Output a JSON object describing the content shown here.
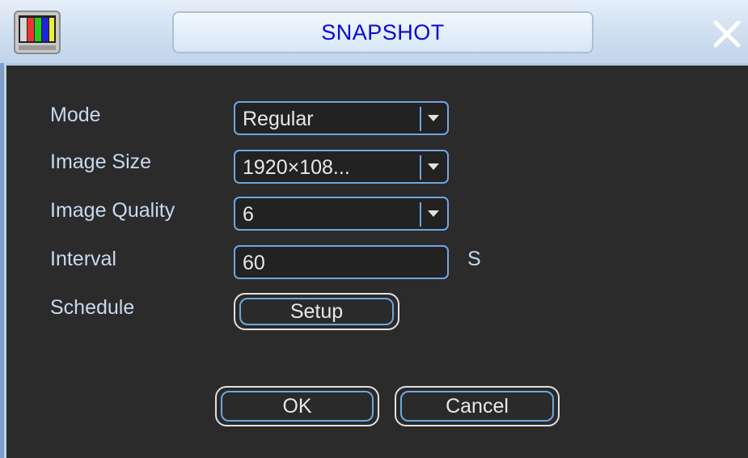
{
  "window": {
    "title": "SNAPSHOT",
    "app_icon": "color-bars-icon",
    "close_icon": "close-icon"
  },
  "form": {
    "mode": {
      "label": "Mode",
      "value": "Regular"
    },
    "image_size": {
      "label": "Image Size",
      "value": "1920×108..."
    },
    "image_quality": {
      "label": "Image Quality",
      "value": "6"
    },
    "interval": {
      "label": "Interval",
      "value": "60",
      "unit": "S"
    },
    "schedule": {
      "label": "Schedule",
      "button": "Setup"
    }
  },
  "buttons": {
    "ok": "OK",
    "cancel": "Cancel"
  },
  "colors": {
    "title_text": "#0a0ad0",
    "label_text": "#c9d9f0",
    "field_border": "#6ea6e0",
    "background": "#2b2b2b"
  }
}
